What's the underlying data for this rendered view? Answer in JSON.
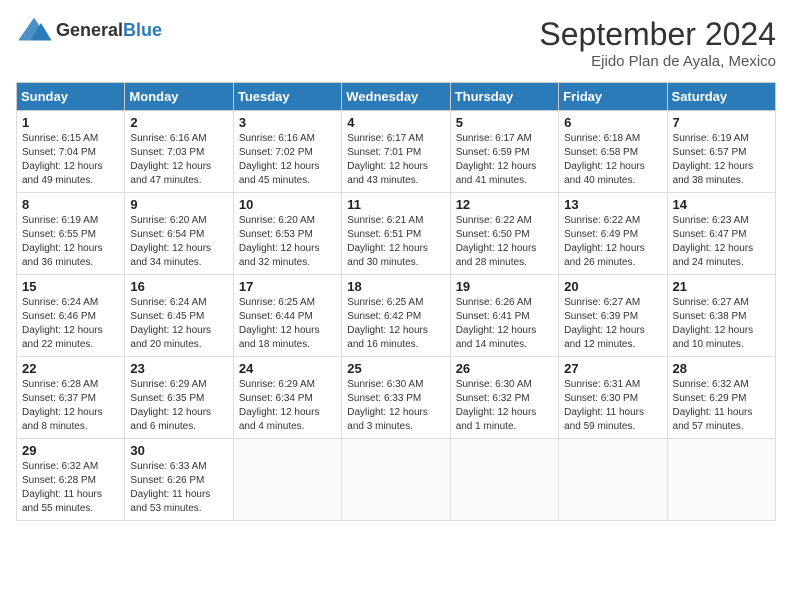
{
  "header": {
    "logo_general": "General",
    "logo_blue": "Blue",
    "title": "September 2024",
    "subtitle": "Ejido Plan de Ayala, Mexico"
  },
  "weekdays": [
    "Sunday",
    "Monday",
    "Tuesday",
    "Wednesday",
    "Thursday",
    "Friday",
    "Saturday"
  ],
  "weeks": [
    [
      {
        "day": "1",
        "info": "Sunrise: 6:15 AM\nSunset: 7:04 PM\nDaylight: 12 hours\nand 49 minutes."
      },
      {
        "day": "2",
        "info": "Sunrise: 6:16 AM\nSunset: 7:03 PM\nDaylight: 12 hours\nand 47 minutes."
      },
      {
        "day": "3",
        "info": "Sunrise: 6:16 AM\nSunset: 7:02 PM\nDaylight: 12 hours\nand 45 minutes."
      },
      {
        "day": "4",
        "info": "Sunrise: 6:17 AM\nSunset: 7:01 PM\nDaylight: 12 hours\nand 43 minutes."
      },
      {
        "day": "5",
        "info": "Sunrise: 6:17 AM\nSunset: 6:59 PM\nDaylight: 12 hours\nand 41 minutes."
      },
      {
        "day": "6",
        "info": "Sunrise: 6:18 AM\nSunset: 6:58 PM\nDaylight: 12 hours\nand 40 minutes."
      },
      {
        "day": "7",
        "info": "Sunrise: 6:19 AM\nSunset: 6:57 PM\nDaylight: 12 hours\nand 38 minutes."
      }
    ],
    [
      {
        "day": "8",
        "info": "Sunrise: 6:19 AM\nSunset: 6:55 PM\nDaylight: 12 hours\nand 36 minutes."
      },
      {
        "day": "9",
        "info": "Sunrise: 6:20 AM\nSunset: 6:54 PM\nDaylight: 12 hours\nand 34 minutes."
      },
      {
        "day": "10",
        "info": "Sunrise: 6:20 AM\nSunset: 6:53 PM\nDaylight: 12 hours\nand 32 minutes."
      },
      {
        "day": "11",
        "info": "Sunrise: 6:21 AM\nSunset: 6:51 PM\nDaylight: 12 hours\nand 30 minutes."
      },
      {
        "day": "12",
        "info": "Sunrise: 6:22 AM\nSunset: 6:50 PM\nDaylight: 12 hours\nand 28 minutes."
      },
      {
        "day": "13",
        "info": "Sunrise: 6:22 AM\nSunset: 6:49 PM\nDaylight: 12 hours\nand 26 minutes."
      },
      {
        "day": "14",
        "info": "Sunrise: 6:23 AM\nSunset: 6:47 PM\nDaylight: 12 hours\nand 24 minutes."
      }
    ],
    [
      {
        "day": "15",
        "info": "Sunrise: 6:24 AM\nSunset: 6:46 PM\nDaylight: 12 hours\nand 22 minutes."
      },
      {
        "day": "16",
        "info": "Sunrise: 6:24 AM\nSunset: 6:45 PM\nDaylight: 12 hours\nand 20 minutes."
      },
      {
        "day": "17",
        "info": "Sunrise: 6:25 AM\nSunset: 6:44 PM\nDaylight: 12 hours\nand 18 minutes."
      },
      {
        "day": "18",
        "info": "Sunrise: 6:25 AM\nSunset: 6:42 PM\nDaylight: 12 hours\nand 16 minutes."
      },
      {
        "day": "19",
        "info": "Sunrise: 6:26 AM\nSunset: 6:41 PM\nDaylight: 12 hours\nand 14 minutes."
      },
      {
        "day": "20",
        "info": "Sunrise: 6:27 AM\nSunset: 6:39 PM\nDaylight: 12 hours\nand 12 minutes."
      },
      {
        "day": "21",
        "info": "Sunrise: 6:27 AM\nSunset: 6:38 PM\nDaylight: 12 hours\nand 10 minutes."
      }
    ],
    [
      {
        "day": "22",
        "info": "Sunrise: 6:28 AM\nSunset: 6:37 PM\nDaylight: 12 hours\nand 8 minutes."
      },
      {
        "day": "23",
        "info": "Sunrise: 6:29 AM\nSunset: 6:35 PM\nDaylight: 12 hours\nand 6 minutes."
      },
      {
        "day": "24",
        "info": "Sunrise: 6:29 AM\nSunset: 6:34 PM\nDaylight: 12 hours\nand 4 minutes."
      },
      {
        "day": "25",
        "info": "Sunrise: 6:30 AM\nSunset: 6:33 PM\nDaylight: 12 hours\nand 3 minutes."
      },
      {
        "day": "26",
        "info": "Sunrise: 6:30 AM\nSunset: 6:32 PM\nDaylight: 12 hours\nand 1 minute."
      },
      {
        "day": "27",
        "info": "Sunrise: 6:31 AM\nSunset: 6:30 PM\nDaylight: 11 hours\nand 59 minutes."
      },
      {
        "day": "28",
        "info": "Sunrise: 6:32 AM\nSunset: 6:29 PM\nDaylight: 11 hours\nand 57 minutes."
      }
    ],
    [
      {
        "day": "29",
        "info": "Sunrise: 6:32 AM\nSunset: 6:28 PM\nDaylight: 11 hours\nand 55 minutes."
      },
      {
        "day": "30",
        "info": "Sunrise: 6:33 AM\nSunset: 6:26 PM\nDaylight: 11 hours\nand 53 minutes."
      },
      {
        "day": "",
        "info": ""
      },
      {
        "day": "",
        "info": ""
      },
      {
        "day": "",
        "info": ""
      },
      {
        "day": "",
        "info": ""
      },
      {
        "day": "",
        "info": ""
      }
    ]
  ]
}
